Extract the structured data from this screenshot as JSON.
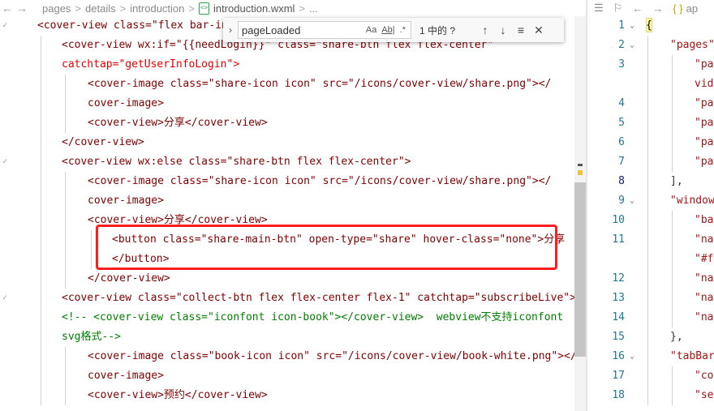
{
  "breadcrumb": {
    "back_icon": "arrow-left-icon",
    "forward_icon": "arrow-right-icon",
    "items": [
      "pages",
      "details",
      "introduction",
      "introduction.wxml",
      "..."
    ],
    "separator": ">"
  },
  "find_widget": {
    "toggle_icon": "chevron-right-icon",
    "value": "pageLoaded",
    "match_case_label": "Aa",
    "whole_word_label": "Ab|",
    "regex_label": ".*",
    "result_text": "1 中的 ?",
    "prev_icon": "arrow-up-icon",
    "next_icon": "arrow-down-icon",
    "selection_icon": "find-in-selection-icon",
    "close_icon": "close-icon"
  },
  "right_panel": {
    "top_icons": [
      "list-icon",
      "bookmark-icon",
      "arrow-left-icon",
      "arrow-right-icon",
      "json-braces-icon"
    ],
    "file_label": "ap",
    "line_numbers": [
      "1",
      "2",
      "3",
      "",
      "4",
      "5",
      "6",
      "7",
      "8",
      "9",
      "10",
      "11",
      "",
      "12",
      "13",
      "14",
      "15",
      "16",
      "17",
      "18"
    ],
    "lines": [
      "{",
      "\"pages\"",
      "\"pa",
      "vid",
      "\"pa",
      "\"pa",
      "\"pa",
      "\"pa",
      "],",
      "\"window",
      "\"ba",
      "\"na",
      "\"#f",
      "\"na",
      "\"na",
      "\"na",
      "},",
      "\"tabBar",
      "\"co",
      "\"se"
    ]
  },
  "highlight": {
    "color": "#ff1d1d"
  },
  "code_lines": [
    "<cover-view class=\"flex bar-in",
    "<cover-view wx:if=\"{{needLogin}}\" class=\"share-btn flex flex-center\"",
    "catchtap=\"getUserInfoLogin\">",
    "<cover-image class=\"share-icon icon\" src=\"/icons/cover-view/share.png\"></",
    "cover-image>",
    "<cover-view>分享</cover-view>",
    "</cover-view>",
    "<cover-view wx:else class=\"share-btn flex flex-center\">",
    "<cover-image class=\"share-icon icon\" src=\"/icons/cover-view/share.png\"></",
    "cover-image>",
    "<cover-view>分享</cover-view>",
    "<button class=\"share-main-btn\" open-type=\"share\" hover-class=\"none\">分享",
    "</button>",
    "</cover-view>",
    "<cover-view class=\"collect-btn flex flex-center flex-1\" catchtap=\"subscribeLive\">",
    "<!-- <cover-view class=\"iconfont icon-book\"></cover-view>  webview不支持iconfont",
    "svg格式-->",
    "<cover-image class=\"book-icon icon\" src=\"/icons/cover-view/book-white.png\"></",
    "cover-image>",
    "<cover-view>预约</cover-view>"
  ]
}
